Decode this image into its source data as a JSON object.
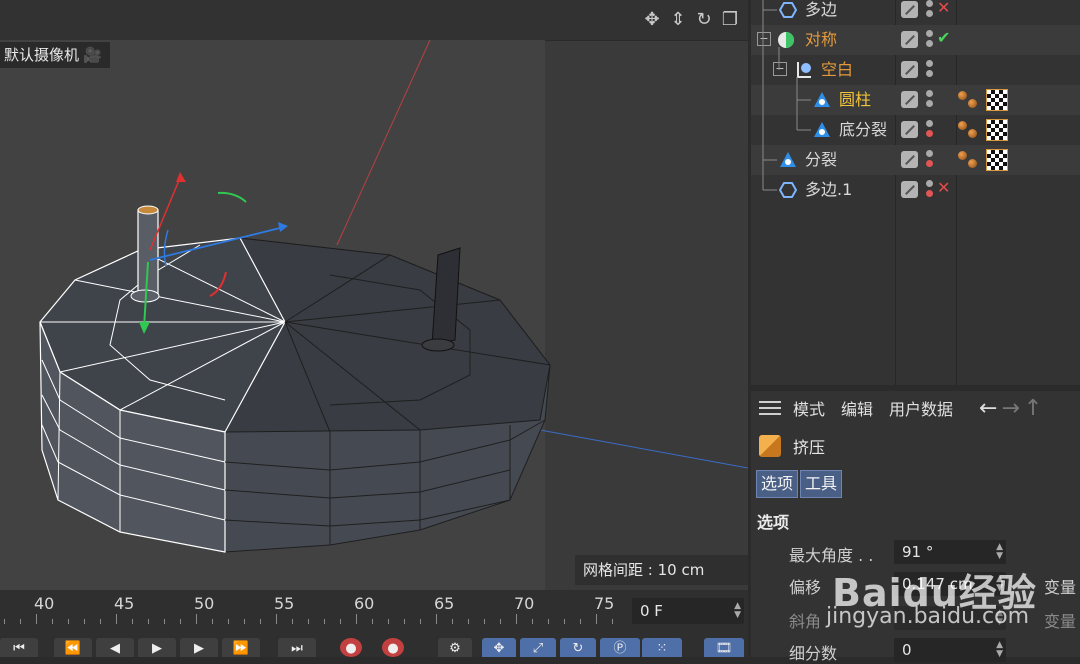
{
  "viewport": {
    "camera_label": "默认摄像机",
    "grid_info": "网格间距 : 10 cm"
  },
  "object_manager": {
    "rows": [
      {
        "name": "多边",
        "color": "normal",
        "status": "x",
        "tags": false
      },
      {
        "name": "对称",
        "color": "orange",
        "status": "check",
        "tags": false
      },
      {
        "name": "空白",
        "color": "orange",
        "status": "none",
        "tags": false
      },
      {
        "name": "圆柱",
        "color": "yellow",
        "status": "none",
        "tags": true
      },
      {
        "name": "底分裂",
        "color": "normal",
        "status": "none",
        "tags": true
      },
      {
        "name": "分裂",
        "color": "normal",
        "status": "none",
        "tags": true
      },
      {
        "name": "多边.1",
        "color": "normal",
        "status": "x",
        "tags": false
      }
    ]
  },
  "attributes": {
    "menu": [
      "模式",
      "编辑",
      "用户数据"
    ],
    "object_name": "挤压",
    "tabs": [
      "选项",
      "工具"
    ],
    "section": "选项",
    "params": [
      {
        "label": "最大角度 . .",
        "value": "91 °",
        "extra": ""
      },
      {
        "label": "偏移",
        "value": "0.147 cm",
        "extra": "变量"
      },
      {
        "label": "斜角",
        "value": "",
        "extra": "变量"
      },
      {
        "label": "细分数",
        "value": "0",
        "extra": ""
      }
    ]
  },
  "timeline": {
    "ticks": [
      "40",
      "45",
      "50",
      "55",
      "60",
      "65",
      "70",
      "75"
    ],
    "current_frame": "0 F"
  },
  "watermark": {
    "brand": "Baidu经验",
    "url": "jingyan.baidu.com"
  },
  "colors": {
    "orange_text": "#e39a3c",
    "yellow_text": "#f2c43a",
    "tab_blue": "#4a5f86",
    "status_red": "#e24b4b",
    "status_green": "#4cd35a"
  }
}
